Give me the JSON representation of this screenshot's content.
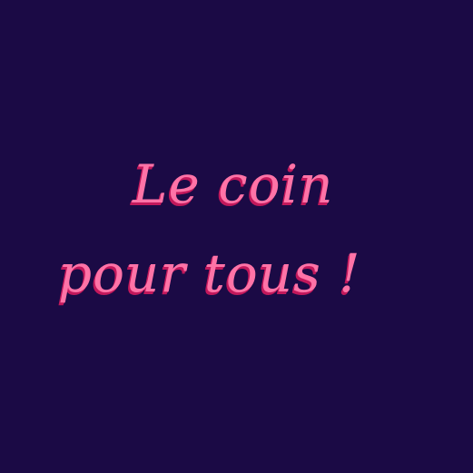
{
  "headline": {
    "line1": "Le coin",
    "line2": "pour tous !"
  },
  "colors": {
    "background": "#1b0a45",
    "text": "#ff73a7",
    "shadow": "#c2185b"
  }
}
